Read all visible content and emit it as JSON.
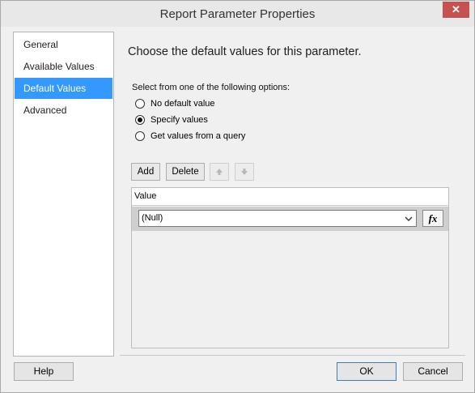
{
  "window": {
    "title": "Report Parameter Properties",
    "close_symbol": "✕"
  },
  "sidebar": {
    "items": [
      {
        "label": "General",
        "selected": false
      },
      {
        "label": "Available Values",
        "selected": false
      },
      {
        "label": "Default Values",
        "selected": true
      },
      {
        "label": "Advanced",
        "selected": false
      }
    ]
  },
  "main": {
    "heading": "Choose the default values for this parameter.",
    "options_label": "Select from one of the following options:",
    "options": [
      {
        "label": "No default value",
        "checked": false
      },
      {
        "label": "Specify values",
        "checked": true
      },
      {
        "label": "Get values from a query",
        "checked": false
      }
    ],
    "toolbar": {
      "add_label": "Add",
      "delete_label": "Delete",
      "move_up_icon": "arrow-up-icon",
      "move_down_icon": "arrow-down-icon"
    },
    "grid": {
      "column_header": "Value",
      "rows": [
        {
          "value": "(Null)"
        }
      ],
      "expression_button": "fx"
    }
  },
  "footer": {
    "help_label": "Help",
    "ok_label": "OK",
    "cancel_label": "Cancel"
  }
}
